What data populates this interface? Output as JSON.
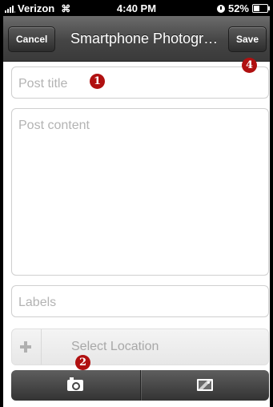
{
  "status_bar": {
    "carrier": "Verizon",
    "time": "4:40 PM",
    "battery": "52%"
  },
  "nav": {
    "cancel_label": "Cancel",
    "title": "Smartphone Photogra...",
    "save_label": "Save"
  },
  "form": {
    "title_placeholder": "Post title",
    "content_placeholder": "Post content",
    "labels_placeholder": "Labels",
    "location_label": "Select Location"
  },
  "toolbar": {
    "buttons": [
      {
        "icon": "camera-icon"
      },
      {
        "icon": "image-icon"
      }
    ]
  },
  "annotations": {
    "badge_1": "1",
    "badge_2": "2",
    "badge_4": "4"
  },
  "colors": {
    "nav_bar": "#454545",
    "badge": "#b01010",
    "placeholder": "#b3b3b3"
  }
}
